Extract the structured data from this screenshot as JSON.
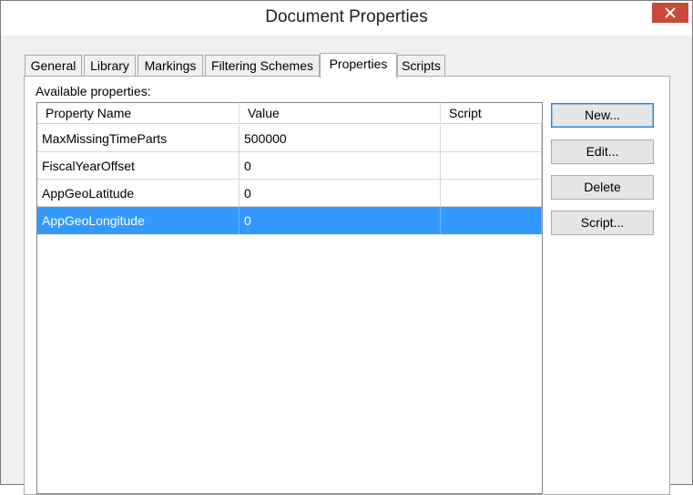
{
  "window": {
    "title": "Document Properties",
    "close_icon": "close-icon"
  },
  "tabs": [
    {
      "label": "General",
      "active": false
    },
    {
      "label": "Library",
      "active": false
    },
    {
      "label": "Markings",
      "active": false
    },
    {
      "label": "Filtering Schemes",
      "active": false
    },
    {
      "label": "Properties",
      "active": true
    },
    {
      "label": "Scripts",
      "active": false
    }
  ],
  "properties": {
    "available_label": "Available properties:",
    "columns": [
      "Property Name",
      "Value",
      "Script"
    ],
    "rows": [
      {
        "name": "MaxMissingTimeParts",
        "value": "500000",
        "script": "",
        "selected": false
      },
      {
        "name": "FiscalYearOffset",
        "value": "0",
        "script": "",
        "selected": false
      },
      {
        "name": "AppGeoLatitude",
        "value": "0",
        "script": "",
        "selected": false
      },
      {
        "name": "AppGeoLongitude",
        "value": "0",
        "script": "",
        "selected": true
      }
    ]
  },
  "buttons": {
    "new": "New...",
    "edit": "Edit...",
    "delete": "Delete",
    "script": "Script..."
  },
  "colors": {
    "selection": "#3399ff",
    "close_button": "#c9493a",
    "dialog_background": "#f0f0f0"
  }
}
